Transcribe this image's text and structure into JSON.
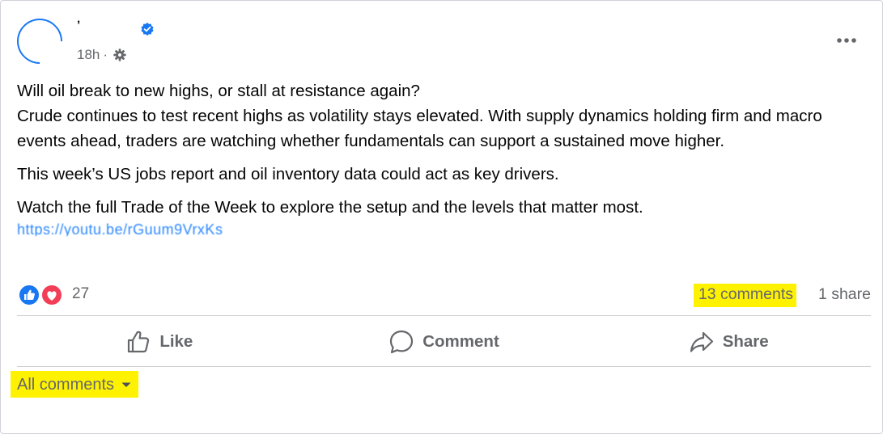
{
  "post": {
    "author_name": "ʼ",
    "time": "18h",
    "separator": "·",
    "text": {
      "question": "Will oil break to new highs, or stall at resistance again?",
      "paragraph1": "Crude continues to test recent highs as volatility stays elevated. With supply dynamics holding firm and macro events ahead, traders are watching whether fundamentals can support a sustained move higher.",
      "paragraph2": "This week’s US jobs report and oil inventory data could act as key drivers.",
      "paragraph3": "Watch the full Trade of the Week to explore the setup and the levels that matter most.",
      "link": "https://youtu.be/rGuum9VrxKs"
    },
    "reactions": {
      "count": "27",
      "types": [
        "like",
        "love"
      ]
    },
    "comments_count": "13 comments",
    "shares_count": "1 share"
  },
  "actions": {
    "like": "Like",
    "comment": "Comment",
    "share": "Share"
  },
  "comments_filter": {
    "label": "All comments"
  },
  "colors": {
    "brand_blue": "#1877f2",
    "love_red": "#f33e58",
    "highlight": "#fff200",
    "secondary_text": "#65676b"
  },
  "icons": [
    "verified-icon",
    "gear-icon",
    "more-icon",
    "like-reaction-icon",
    "love-reaction-icon",
    "thumbs-up-icon",
    "comment-bubble-icon",
    "share-arrow-icon",
    "caret-down-icon"
  ]
}
